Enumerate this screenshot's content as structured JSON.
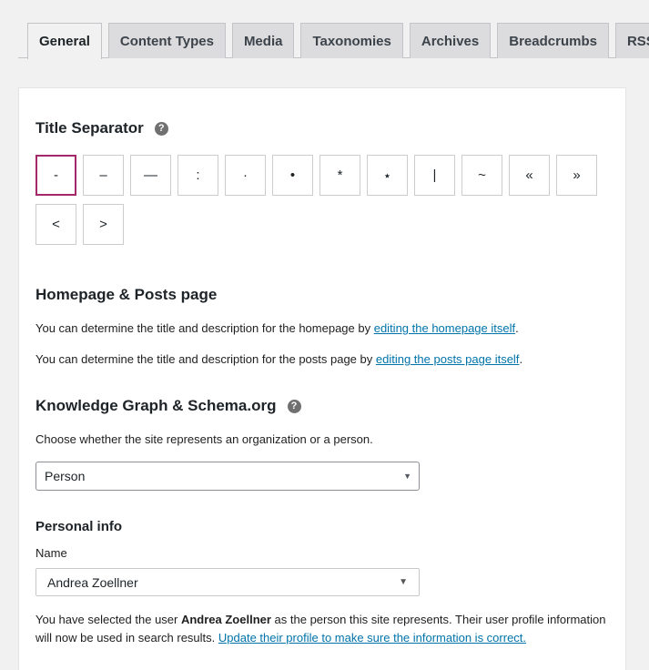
{
  "tabs": [
    "General",
    "Content Types",
    "Media",
    "Taxonomies",
    "Archives",
    "Breadcrumbs",
    "RSS"
  ],
  "active_tab": "General",
  "title_separator": {
    "heading": "Title Separator",
    "help": "?",
    "options": [
      "-",
      "–",
      "—",
      ":",
      "·",
      "•",
      "*",
      "⋆",
      "|",
      "~",
      "«",
      "»",
      "<",
      ">"
    ],
    "selected": "-"
  },
  "homepage": {
    "heading": "Homepage & Posts page",
    "line1_text": "You can determine the title and description for the homepage by ",
    "line1_link": "editing the homepage itself",
    "line1_end": ".",
    "line2_text": "You can determine the title and description for the posts page by ",
    "line2_link": "editing the posts page itself",
    "line2_end": "."
  },
  "knowledge_graph": {
    "heading": "Knowledge Graph & Schema.org",
    "help": "?",
    "description": "Choose whether the site represents an organization or a person.",
    "type_value": "Person"
  },
  "personal_info": {
    "heading": "Personal info",
    "name_label": "Name",
    "name_value": "Andrea Zoellner",
    "note_prefix": "You have selected the user ",
    "note_user": "Andrea Zoellner",
    "note_suffix": " as the person this site represents. Their user profile information will now be used in search results. ",
    "note_link": "Update their profile to make sure the information is correct."
  },
  "icons": {
    "help": "question-circle-icon",
    "caret": "caret-down-icon"
  },
  "colors": {
    "selected_border": "#a4286a",
    "link": "#0073aa"
  }
}
